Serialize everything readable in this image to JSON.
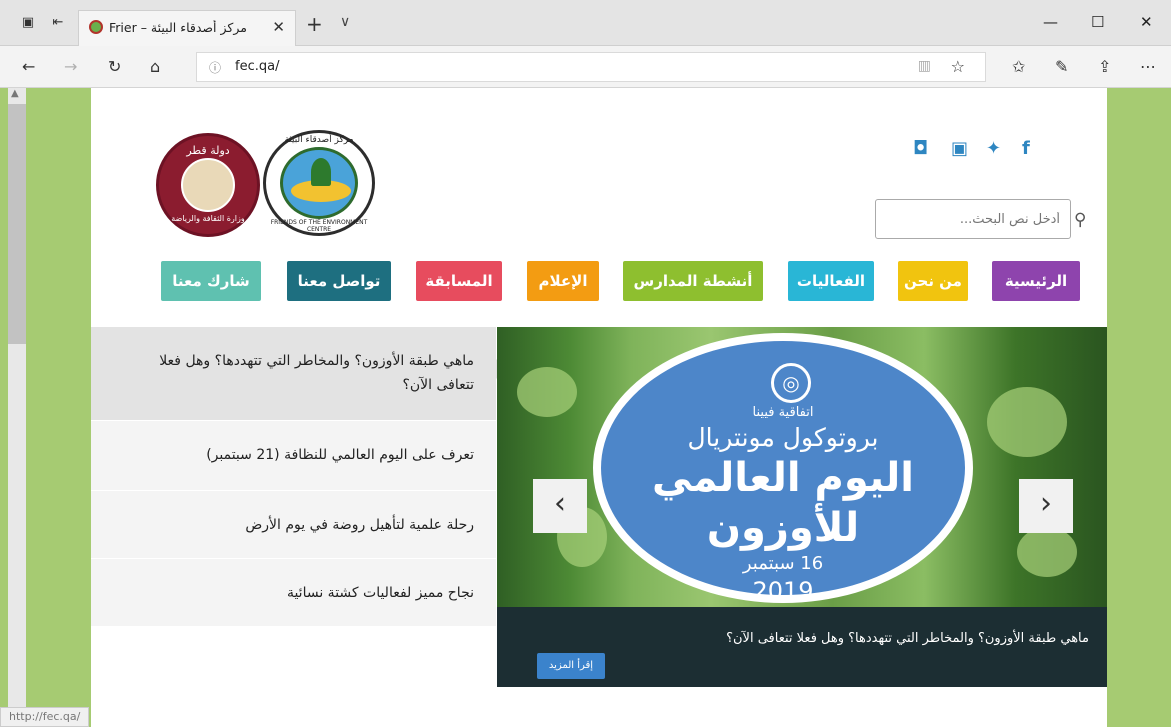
{
  "browser": {
    "tab_title": "مركز أصدقاء البيئة – Frier",
    "url": "fec.qa/",
    "status_url": "http://fec.qa/"
  },
  "header": {
    "qatar_logo_top": "دولة قطر",
    "qatar_logo_bottom": "وزارة الثقافة والرياضة",
    "fec_logo_top": "مركز أصدقاء البيئة",
    "fec_logo_bottom": "FRIENDS OF THE ENVIRONMENT CENTRE",
    "social_icons": [
      "instagram-icon",
      "youtube-icon",
      "twitter-icon",
      "facebook-icon"
    ],
    "search_placeholder": "أدخل نص البحث..."
  },
  "menu": [
    {
      "label": "الرئيسية",
      "color": "#8e44ad"
    },
    {
      "label": "من نحن",
      "color": "#f1c40f"
    },
    {
      "label": "الفعاليات",
      "color": "#29b6d6"
    },
    {
      "label": "أنشطة المدارس",
      "color": "#8ebf2f"
    },
    {
      "label": "الإعلام",
      "color": "#f39c12"
    },
    {
      "label": "المسابقة",
      "color": "#e74c5e"
    },
    {
      "label": "تواصل معنا",
      "color": "#1e6f80"
    },
    {
      "label": "شارك معنا",
      "color": "#5fc1b0"
    }
  ],
  "news": [
    {
      "title": "ماهي طبقة الأوزون؟ والمخاطر التي تتهددها؟ وهل فعلا تتعافى الآن؟"
    },
    {
      "title": "تعرف على اليوم العالمي للنظافة (21 سبتمبر)"
    },
    {
      "title": "رحلة علمية لتأهيل روضة في يوم الأرض"
    },
    {
      "title": "نجاح مميز لفعاليات كشتة نسائية"
    }
  ],
  "slide": {
    "line1": "اتفاقية فيينا",
    "line2": "بروتوكول مونتريال",
    "line3": "اليوم العالمي",
    "line4": "للأوزون",
    "line5": "16 سبتمبر",
    "line6": "2019",
    "caption": "ماهي طبقة الأوزون؟ والمخاطر التي تتهددها؟ وهل فعلا تتعافى الآن؟",
    "more_label": "إقرأ المزيد"
  }
}
